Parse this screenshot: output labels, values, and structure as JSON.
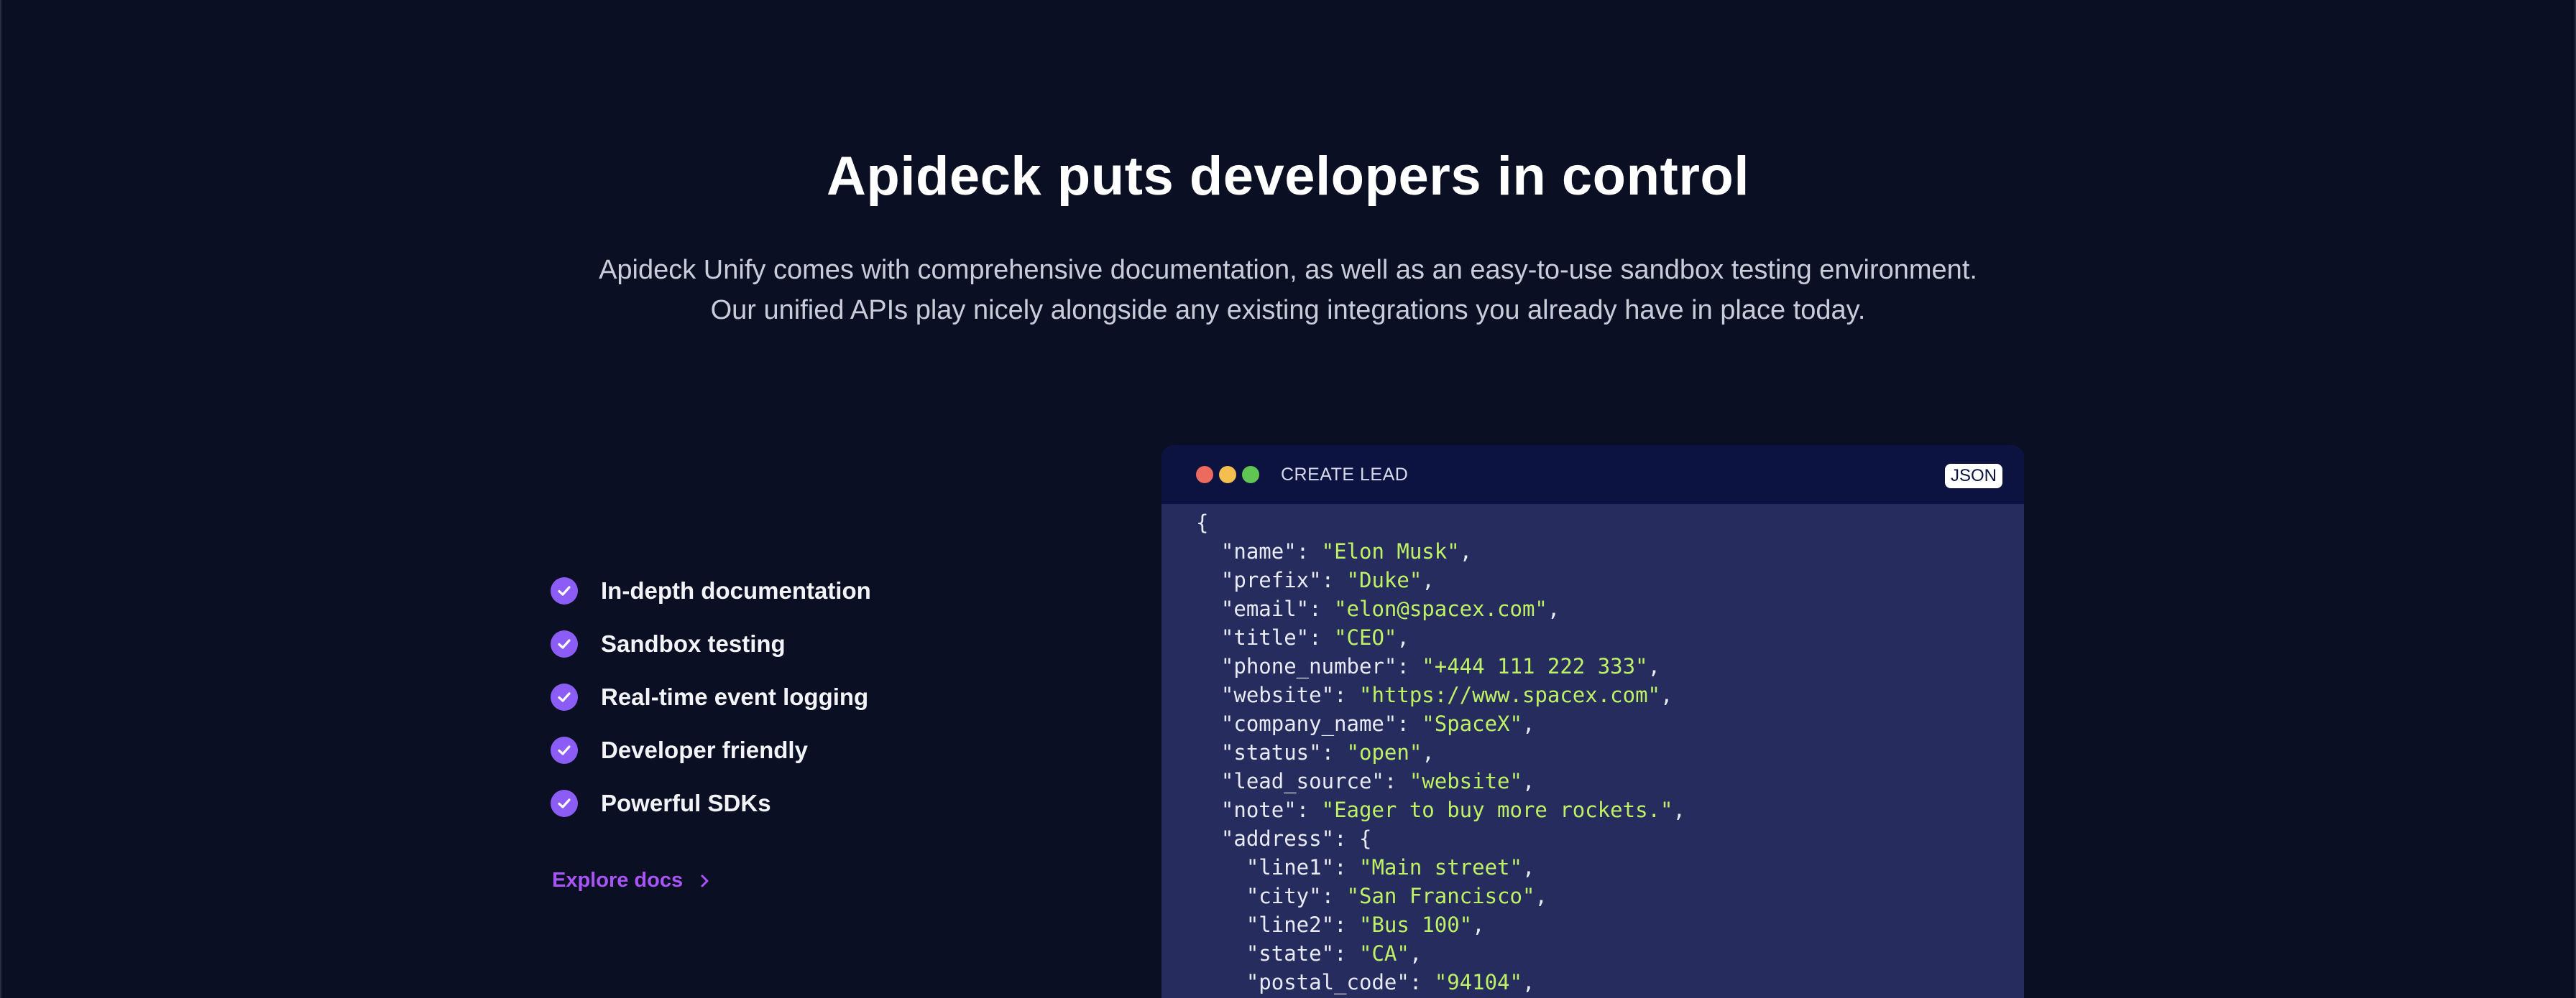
{
  "hero": {
    "title": "Apideck puts developers in control",
    "subtitle_line1": "Apideck Unify comes with comprehensive documentation, as well as an easy-to-use sandbox testing environment.",
    "subtitle_line2": "Our unified APIs play nicely alongside any existing integrations you already have in place today."
  },
  "features": [
    {
      "label": "In-depth documentation",
      "icon": "check-circle-icon"
    },
    {
      "label": "Sandbox testing",
      "icon": "check-circle-icon"
    },
    {
      "label": "Real-time event logging",
      "icon": "check-circle-icon"
    },
    {
      "label": "Developer friendly",
      "icon": "check-circle-icon"
    },
    {
      "label": "Powerful SDKs",
      "icon": "check-circle-icon"
    }
  ],
  "explore_link": {
    "label": "Explore docs",
    "icon": "chevron-right-icon"
  },
  "code_window": {
    "title": "CREATE LEAD",
    "badge": "JSON",
    "window_controls": [
      "close",
      "minimize",
      "maximize"
    ],
    "lines": [
      {
        "indent": "",
        "key": "",
        "value": "",
        "open": "{",
        "comma": ""
      },
      {
        "indent": "  ",
        "key": "name",
        "value": "Elon Musk",
        "comma": ","
      },
      {
        "indent": "  ",
        "key": "prefix",
        "value": "Duke",
        "comma": ","
      },
      {
        "indent": "  ",
        "key": "email",
        "value": "elon@spacex.com",
        "comma": ","
      },
      {
        "indent": "  ",
        "key": "title",
        "value": "CEO",
        "comma": ","
      },
      {
        "indent": "  ",
        "key": "phone_number",
        "value": "+444 111 222 333",
        "comma": ","
      },
      {
        "indent": "  ",
        "key": "website",
        "value": "https://www.spacex.com",
        "comma": ","
      },
      {
        "indent": "  ",
        "key": "company_name",
        "value": "SpaceX",
        "comma": ","
      },
      {
        "indent": "  ",
        "key": "status",
        "value": "open",
        "comma": ","
      },
      {
        "indent": "  ",
        "key": "lead_source",
        "value": "website",
        "comma": ","
      },
      {
        "indent": "  ",
        "key": "note",
        "value": "Eager to buy more rockets.",
        "comma": ","
      },
      {
        "indent": "  ",
        "key": "address",
        "value": "",
        "open": "{",
        "comma": ""
      },
      {
        "indent": "    ",
        "key": "line1",
        "value": "Main street",
        "comma": ","
      },
      {
        "indent": "    ",
        "key": "city",
        "value": "San Francisco",
        "comma": ","
      },
      {
        "indent": "    ",
        "key": "line2",
        "value": "Bus 100",
        "comma": ","
      },
      {
        "indent": "    ",
        "key": "state",
        "value": "CA",
        "comma": ","
      },
      {
        "indent": "    ",
        "key": "postal_code",
        "value": "94104",
        "comma": ","
      }
    ]
  },
  "colors": {
    "background": "#0b0f23",
    "accent": "#8b5cf6",
    "link": "#a855f7",
    "code_bg": "#262c5e",
    "code_header": "#0d1340",
    "string": "#bef264",
    "dot_red": "#ed6a5e",
    "dot_yellow": "#f4bf4f",
    "dot_green": "#61c554"
  }
}
